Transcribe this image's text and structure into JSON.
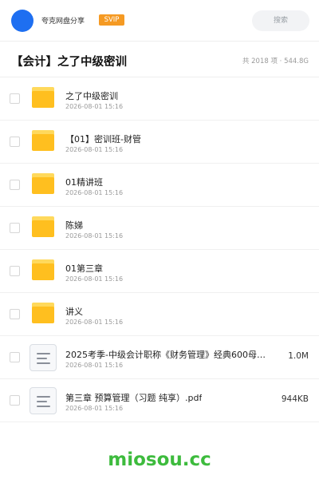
{
  "header": {
    "share_name": "夸克网盘分享",
    "badge": "SVIP",
    "search_placeholder": "搜索"
  },
  "folder": {
    "title": "【会计】之了中级密训",
    "meta": "共 2018 项 · 544.8G"
  },
  "items": [
    {
      "type": "folder",
      "name": "之了中级密训",
      "date": "2026-08-01 15:16",
      "size": ""
    },
    {
      "type": "folder",
      "name": "【01】密训班-财管",
      "date": "2026-08-01 15:16",
      "size": ""
    },
    {
      "type": "folder",
      "name": "01精讲班",
      "date": "2026-08-01 15:16",
      "size": ""
    },
    {
      "type": "folder",
      "name": "陈娣",
      "date": "2026-08-01 15:16",
      "size": ""
    },
    {
      "type": "folder",
      "name": "01第三章",
      "date": "2026-08-01 15:16",
      "size": ""
    },
    {
      "type": "folder",
      "name": "讲义",
      "date": "2026-08-01 15:16",
      "size": ""
    },
    {
      "type": "file",
      "name": "2025考季-中级会计职称《财务管理》经典600母…",
      "date": "2026-08-01 15:16",
      "size": "1.0M"
    },
    {
      "type": "file",
      "name": "第三章 预算管理（习题 纯享）.pdf",
      "date": "2026-08-01 15:16",
      "size": "944KB"
    }
  ],
  "watermark": "miosou.cc",
  "colors": {
    "avatar": "#1e6ff1",
    "svip_badge": "#f59a23",
    "folder_icon": "#ffbf1f",
    "watermark": "#3dbb3d"
  }
}
